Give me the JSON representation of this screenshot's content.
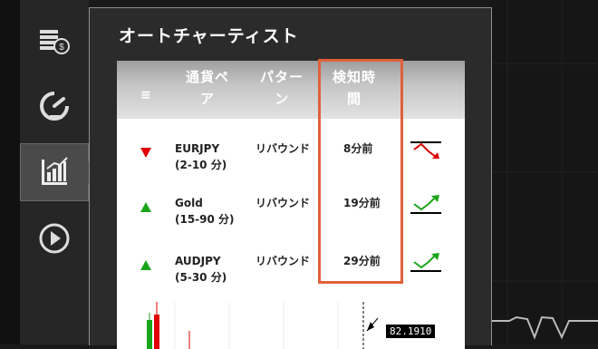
{
  "panel": {
    "title": "オートチャーティスト"
  },
  "table": {
    "headers": {
      "menu_icon": "≡",
      "currency_l1": "通貨ペ",
      "currency_l2": "ア",
      "pattern_l1": "パター",
      "pattern_l2": "ン",
      "time_l1": "検知時",
      "time_l2": "間"
    },
    "rows": [
      {
        "direction": "down",
        "pair": "EURJPY",
        "range": "(2-10 分)",
        "pattern": "リバウンド",
        "time": "8分前",
        "trend_icon": "trend-down-icon"
      },
      {
        "direction": "up",
        "pair": "Gold",
        "range": "(15-90 分)",
        "pattern": "リバウンド",
        "time": "19分前",
        "trend_icon": "trend-up-icon"
      },
      {
        "direction": "up",
        "pair": "AUDJPY",
        "range": "(5-30 分)",
        "pattern": "リバウンド",
        "time": "29分前",
        "trend_icon": "trend-up-icon"
      }
    ]
  },
  "preview": {
    "price": "82.1910"
  },
  "sidebar": {
    "items": [
      {
        "icon": "coins-icon"
      },
      {
        "icon": "speed-clock-icon"
      },
      {
        "icon": "bar-chart-icon",
        "active": true
      },
      {
        "icon": "play-icon"
      }
    ]
  },
  "colors": {
    "down": "#e00000",
    "up": "#1aa51a",
    "highlight": "#e0603a"
  }
}
